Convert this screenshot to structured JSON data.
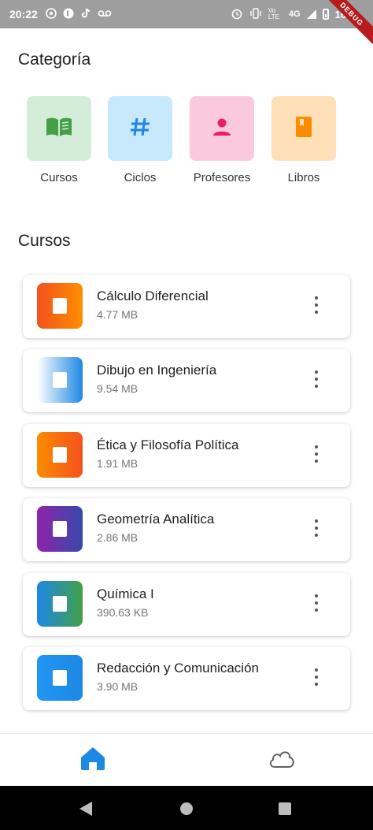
{
  "status_bar": {
    "time": "20:22",
    "network": "4G",
    "battery_text": "16",
    "left_icons": [
      "whatsapp-icon",
      "app-icon",
      "tiktok-icon",
      "voicemail-icon"
    ],
    "right_icons": [
      "alarm-icon",
      "vibrate-icon",
      "volte-icon",
      "signal-icon",
      "battery-icon"
    ],
    "volte_label": "Vo LTE",
    "debug_label": "DEBUG"
  },
  "categories_section": {
    "title": "Categoría",
    "items": [
      {
        "label": "Cursos",
        "icon": "book-open-icon",
        "bg": "#d4edd9",
        "fg": "#43a047"
      },
      {
        "label": "Ciclos",
        "icon": "hash-icon",
        "bg": "#c8e8fb",
        "fg": "#1e88e5"
      },
      {
        "label": "Profesores",
        "icon": "person-icon",
        "bg": "#fbc9dc",
        "fg": "#e91e63"
      },
      {
        "label": "Libros",
        "icon": "book-icon",
        "bg": "#ffdfb8",
        "fg": "#fb8c00"
      }
    ]
  },
  "courses_section": {
    "title": "Cursos",
    "items": [
      {
        "title": "Cálculo Diferencial",
        "size": "4.77 MB",
        "gradient": [
          "#f4511e",
          "#ff8f00"
        ]
      },
      {
        "title": "Dibujo en Ingeniería",
        "size": "9.54 MB",
        "gradient": [
          "#ffffff",
          "#1e88e5"
        ]
      },
      {
        "title": "Ética y Filosofía Política",
        "size": "1.91 MB",
        "gradient": [
          "#fb8c00",
          "#f4511e"
        ]
      },
      {
        "title": "Geometría Analítica",
        "size": "2.86 MB",
        "gradient": [
          "#8e24aa",
          "#3949ab"
        ]
      },
      {
        "title": "Química I",
        "size": "390.63 KB",
        "gradient": [
          "#1e88e5",
          "#43a047"
        ]
      },
      {
        "title": "Redacción y Comunicación",
        "size": "3.90 MB",
        "gradient": [
          "#2196f3",
          "#1e88e5"
        ]
      }
    ]
  },
  "bottom_nav": {
    "items": [
      {
        "icon": "home-icon",
        "active": true,
        "color": "#1e88e5"
      },
      {
        "icon": "cloud-icon",
        "active": false,
        "color": "#616161"
      }
    ]
  },
  "colors": {
    "accent": "#1e88e5",
    "status_bar": "#9e9e9e",
    "debug_banner": "#b71c1c"
  }
}
